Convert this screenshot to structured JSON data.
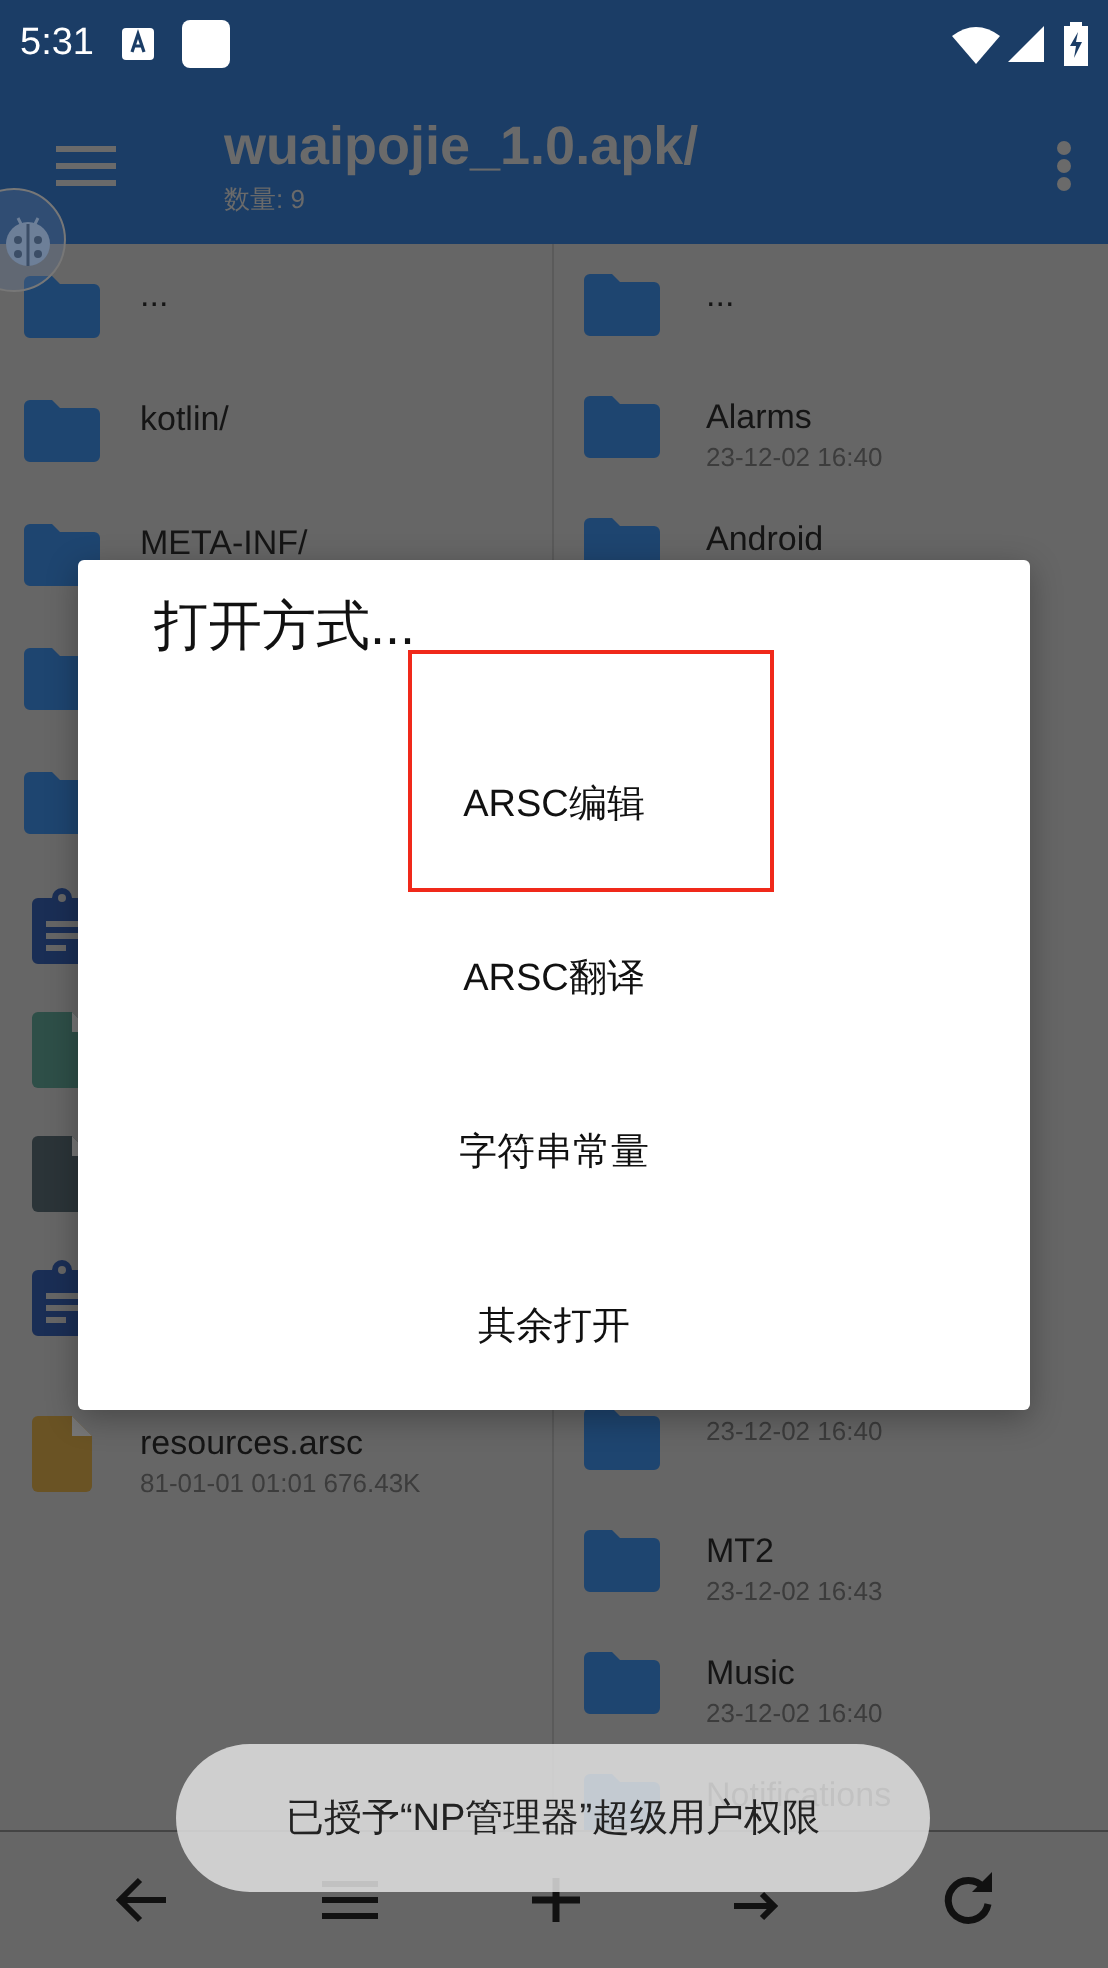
{
  "status_bar": {
    "time": "5:31"
  },
  "app_bar": {
    "title": "wuaipojie_1.0.apk/",
    "subtitle": "数量: 9"
  },
  "left_panel": {
    "items": [
      {
        "kind": "folder",
        "name": "..."
      },
      {
        "kind": "folder",
        "name": "kotlin/"
      },
      {
        "kind": "folder",
        "name": "META-INF/"
      },
      {
        "kind": "folder"
      },
      {
        "kind": "folder"
      },
      {
        "kind": "clipboard"
      },
      {
        "kind": "file",
        "color": "#2e4f48"
      },
      {
        "kind": "file",
        "color": "#2b3438"
      },
      {
        "kind": "clipboard"
      },
      {
        "kind": "file",
        "color": "#6a5324",
        "name": "resources.arsc",
        "meta": "81-01-01 01:01  676.43K"
      }
    ]
  },
  "right_panel": {
    "top_items": [
      {
        "kind": "folder",
        "name": "..."
      },
      {
        "kind": "folder",
        "name": "Alarms",
        "meta": "23-12-02 16:40"
      },
      {
        "kind": "folder",
        "name": "Android"
      }
    ],
    "bottom_items": [
      {
        "kind": "folder",
        "meta": "23-12-02 16:40"
      },
      {
        "kind": "folder",
        "name": "MT2",
        "meta": "23-12-02 16:43"
      },
      {
        "kind": "folder",
        "name": "Music",
        "meta": "23-12-02 16:40"
      },
      {
        "kind": "folder",
        "name": "Notifications"
      }
    ]
  },
  "dialog": {
    "title": "打开方式...",
    "options": [
      {
        "label": "ARSC编辑",
        "highlighted": true
      },
      {
        "label": "ARSC翻译",
        "highlighted": false
      },
      {
        "label": "字符串常量",
        "highlighted": false
      },
      {
        "label": "其余打开",
        "highlighted": false
      }
    ]
  },
  "toast": {
    "message": "已授予“NP管理器”超级用户权限"
  },
  "bottom_bar": {
    "actions": [
      {
        "kind": "back"
      },
      {
        "kind": "menu"
      },
      {
        "kind": "add"
      },
      {
        "kind": "swap"
      },
      {
        "kind": "refresh"
      }
    ]
  }
}
